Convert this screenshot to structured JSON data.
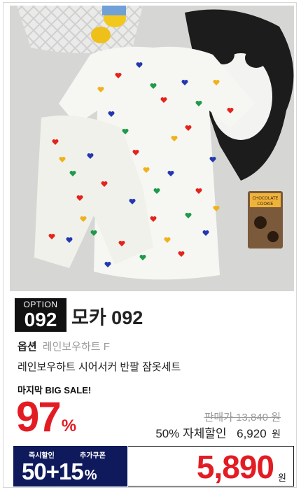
{
  "product": {
    "option_label": "OPTION",
    "option_number": "092",
    "title": "모카 092",
    "option_key": "옵션",
    "option_value": "레인보우하트 F",
    "description": "레인보우하트 시어서커 반팔 잠옷세트"
  },
  "photo": {
    "box_text_1": "CHOCOLATE",
    "box_text_2": "COOKIE"
  },
  "sale": {
    "label": "마지막 BIG SALE!",
    "percent": "97",
    "percent_symbol": "%",
    "original_price": "판매가 13,840 원",
    "discount_label": "50% 자체할인",
    "discount_price": "6,920",
    "discount_unit": "원"
  },
  "coupon": {
    "label_instant": "즉시할인",
    "label_extra": "추가쿠폰",
    "combo": "50+15",
    "combo_symbol": "%"
  },
  "final": {
    "price": "5,890",
    "unit": "원"
  },
  "colors": {
    "accent_red": "#e31b23",
    "coupon_navy": "#0f1a5c"
  }
}
